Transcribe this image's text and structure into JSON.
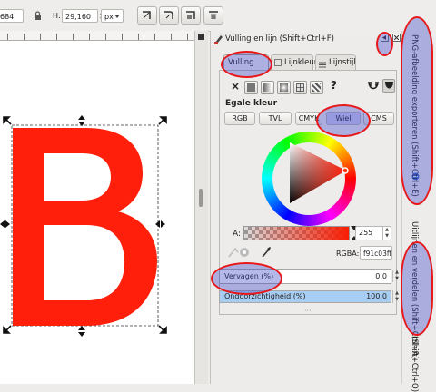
{
  "toolbar": {
    "x_value": "684",
    "h_label": "H:",
    "h_value": "29,160",
    "unit": "px",
    "lock_icon": "lock-icon",
    "buttons": [
      "scale-stroke-icon",
      "scale-corners-icon",
      "scale-gradient-icon",
      "scale-pattern-icon"
    ]
  },
  "canvas": {
    "letter": "B",
    "letter_color": "#ff1f0a"
  },
  "dialog": {
    "title": "Vulling en lijn (Shift+Ctrl+F)",
    "tabs": [
      "Vulling",
      "Lijnkleur",
      "Lijnstijl"
    ],
    "no_paint_glyph": "×",
    "unset_glyph": "?",
    "section_label": "Egale kleur",
    "color_modes": [
      "RGB",
      "TVL",
      "CMYK",
      "Wiel",
      "CMS"
    ],
    "alpha_label": "A:",
    "alpha_value": "255",
    "rgba_label": "RGBA:",
    "rgba_value": "f91c03ff",
    "blend_label": "Vervagen (%)",
    "blend_value": "0,0",
    "opacity_label": "Ondoorzichtigheid (%)",
    "opacity_value": "100,0",
    "opacity_fraction": 1.0,
    "more_glyph": "···"
  },
  "dock": {
    "top_label": "PNG-afbeelding exporteren (Shift+Ctrl+E)",
    "bottom_label": "Uitlijnen en verdelen (Shift+Ctrl+A)",
    "cut_label": "(Shift+Ctrl+O)"
  },
  "colors": {
    "fill": "#f91c03",
    "highlight_border": "#e8181a",
    "highlight_fill": "#3c46c8",
    "opacity_bar": "#a8cdf3"
  }
}
